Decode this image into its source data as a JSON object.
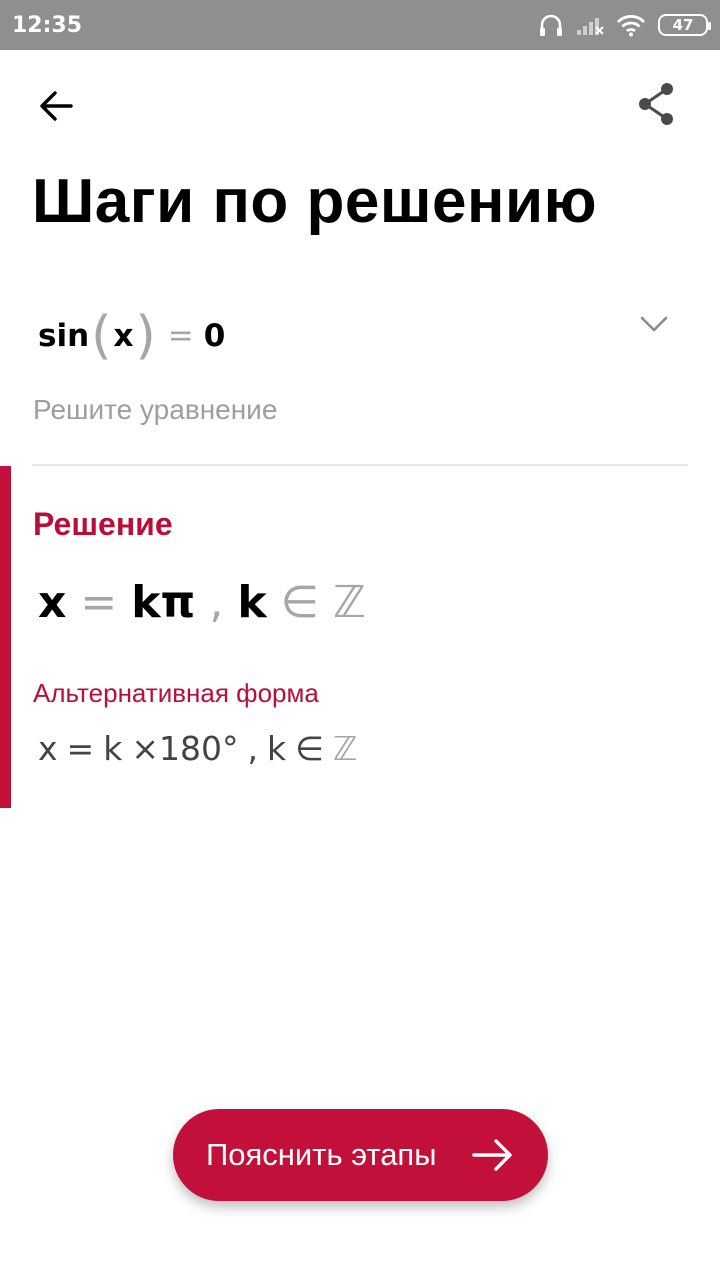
{
  "status_bar": {
    "time": "12:35",
    "battery": "47",
    "icons": [
      "headphones-icon",
      "cellular-signal-icon",
      "wifi-icon",
      "battery-icon"
    ]
  },
  "toolbar": {
    "back_icon": "arrow-left-icon",
    "share_icon": "share-icon"
  },
  "page": {
    "title": "Шаги по решению"
  },
  "problem": {
    "fn": "sin",
    "paren_open": "(",
    "var": "x",
    "paren_close": ")",
    "eq": "=",
    "rhs": "0",
    "label": "Решите уравнение",
    "expand_icon": "chevron-down-icon"
  },
  "solution": {
    "header": "Решение",
    "lhs": "x",
    "eq": "=",
    "rhs": "kπ",
    "comma": ",",
    "param": "k",
    "in": "∈",
    "set": "ℤ"
  },
  "alternative": {
    "header": "Альтернативная форма",
    "lhs": "x",
    "eq": "=",
    "k": "k",
    "times": "×",
    "value": "180°",
    "comma": ",",
    "param": "k",
    "in": "∈",
    "set": "ℤ"
  },
  "action": {
    "label": "Пояснить этапы",
    "icon": "arrow-right-icon"
  },
  "colors": {
    "accent": "#C2103B",
    "status_bar": "#8F8F8F",
    "muted_text": "#9E9E9E"
  }
}
